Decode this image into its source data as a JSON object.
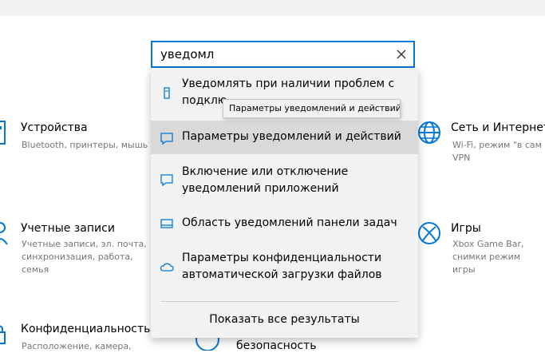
{
  "categories": {
    "devices": {
      "title": "Устройства",
      "desc": "Bluetooth, принтеры, мышь",
      "icon": "keyboard-icon"
    },
    "network": {
      "title": "Сеть и Интернет",
      "desc": "Wi-Fi, режим \"в сам VPN",
      "icon": "globe-icon"
    },
    "accounts": {
      "title": "Учетные записи",
      "desc": "Учетные записи, эл. почта, синхронизация, работа, семья",
      "icon": "person-icon"
    },
    "games": {
      "title": "Игры",
      "desc": "Xbox Game Bar, снимки режим игры",
      "icon": "xbox-icon"
    },
    "privacy": {
      "title": "Конфиденциальность",
      "desc": "Расположение, камера,",
      "icon": "lock-icon"
    },
    "security": {
      "title": "безопасность",
      "icon": "shield-icon"
    }
  },
  "search": {
    "value": "уведомл",
    "clear_icon": "close-icon"
  },
  "suggestions": [
    {
      "label": "Уведомлять при наличии проблем с подклю",
      "icon": "usb-icon"
    },
    {
      "label": "Параметры уведомлений и действий",
      "icon": "action-center-icon"
    },
    {
      "label": "Включение или отключение уведомлений приложений",
      "icon": "action-center-icon"
    },
    {
      "label": "Область уведомлений панели задач",
      "icon": "taskbar-icon"
    },
    {
      "label": "Параметры конфиденциальности автоматической загрузки файлов",
      "icon": "cloud-icon"
    }
  ],
  "show_all": "Показать все результаты",
  "tooltip": "Параметры уведомлений и действий",
  "colors": {
    "accent": "#0078d7",
    "text_secondary": "#767676",
    "dropdown_bg": "#f2f2f2",
    "highlight": "#d9d9d9"
  }
}
